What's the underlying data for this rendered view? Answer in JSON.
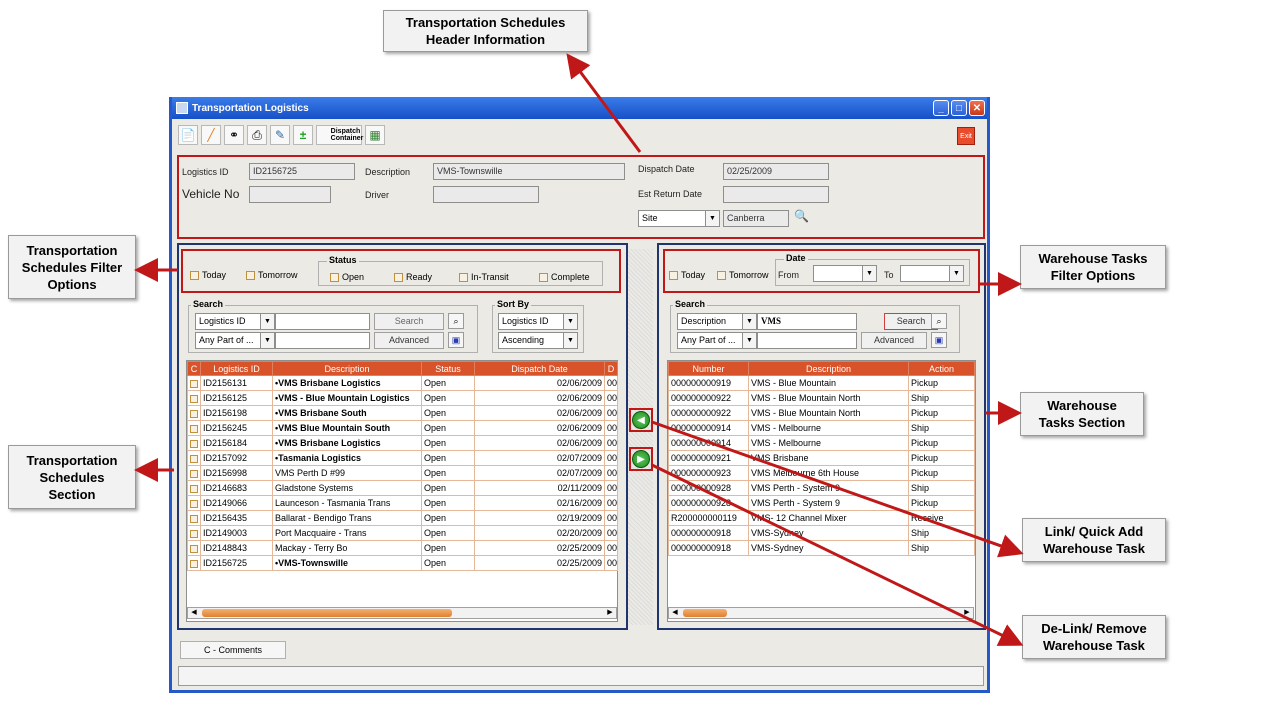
{
  "callouts": {
    "header_info": "Transportation Schedules\nHeader Information",
    "ts_filter": "Transportation\nSchedules Filter\nOptions",
    "ts_section": "Transportation\nSchedules\nSection",
    "wt_filter": "Warehouse Tasks\nFilter Options",
    "wt_section": "Warehouse\nTasks Section",
    "link": "Link/ Quick Add\nWarehouse Task",
    "delink": "De-Link/ Remove\nWarehouse Task"
  },
  "window": {
    "title": "Transportation Logistics",
    "minimize": "_",
    "maximize": "□",
    "close": "✕"
  },
  "toolbar": {
    "dispatch_label": "Dispatch\nContainer",
    "exit_label": "Exit"
  },
  "header": {
    "logistics_id_label": "Logistics ID",
    "logistics_id_value": "ID2156725",
    "description_label": "Description",
    "description_value": "VMS-Townswille",
    "dispatch_date_label": "Dispatch Date",
    "dispatch_date_value": "02/25/2009",
    "vehicle_no_label": "Vehicle No",
    "vehicle_no_value": "",
    "driver_label": "Driver",
    "driver_value": "",
    "est_return_label": "Est Return Date",
    "est_return_value": "",
    "site_label": "Site",
    "site_value": "Canberra"
  },
  "ts_filter": {
    "today": "Today",
    "tomorrow": "Tomorrow",
    "status_title": "Status",
    "open": "Open",
    "ready": "Ready",
    "in_transit": "In-Transit",
    "complete": "Complete"
  },
  "ts_search": {
    "title": "Search",
    "field": "Logistics ID",
    "match": "Any Part of ...",
    "value": "",
    "search_btn": "Search",
    "advanced_btn": "Advanced",
    "sort_title": "Sort By",
    "sort_field": "Logistics ID",
    "sort_order": "Ascending"
  },
  "ts_table": {
    "headers": [
      "C",
      "Logistics ID",
      "Description",
      "Status",
      "Dispatch Date",
      "D"
    ],
    "rows": [
      {
        "id": "ID2156131",
        "desc": "•VMS Brisbane Logistics",
        "bold": true,
        "status": "Open",
        "date": "02/06/2009",
        "d": "00"
      },
      {
        "id": "ID2156125",
        "desc": "•VMS - Blue Mountain Logistics",
        "bold": true,
        "status": "Open",
        "date": "02/06/2009",
        "d": "00"
      },
      {
        "id": "ID2156198",
        "desc": "•VMS Brisbane South",
        "bold": true,
        "status": "Open",
        "date": "02/06/2009",
        "d": "00"
      },
      {
        "id": "ID2156245",
        "desc": "•VMS Blue Mountain South",
        "bold": true,
        "status": "Open",
        "date": "02/06/2009",
        "d": "00"
      },
      {
        "id": "ID2156184",
        "desc": "•VMS Brisbane Logistics",
        "bold": true,
        "status": "Open",
        "date": "02/06/2009",
        "d": "00"
      },
      {
        "id": "ID2157092",
        "desc": "•Tasmania Logistics",
        "bold": true,
        "status": "Open",
        "date": "02/07/2009",
        "d": "00"
      },
      {
        "id": "ID2156998",
        "desc": "VMS Perth D #99",
        "bold": false,
        "status": "Open",
        "date": "02/07/2009",
        "d": "00"
      },
      {
        "id": "ID2146683",
        "desc": "Gladstone Systems",
        "bold": false,
        "status": "Open",
        "date": "02/11/2009",
        "d": "00"
      },
      {
        "id": "ID2149066",
        "desc": "Launceson - Tasmania Trans",
        "bold": false,
        "status": "Open",
        "date": "02/16/2009",
        "d": "00"
      },
      {
        "id": "ID2156435",
        "desc": "Ballarat - Bendigo Trans",
        "bold": false,
        "status": "Open",
        "date": "02/19/2009",
        "d": "00"
      },
      {
        "id": "ID2149003",
        "desc": "Port Macquaire - Trans",
        "bold": false,
        "status": "Open",
        "date": "02/20/2009",
        "d": "00"
      },
      {
        "id": "ID2148843",
        "desc": "Mackay - Terry Bo",
        "bold": false,
        "status": "Open",
        "date": "02/25/2009",
        "d": "00"
      },
      {
        "id": "ID2156725",
        "desc": "•VMS-Townswille",
        "bold": true,
        "status": "Open",
        "date": "02/25/2009",
        "d": "00"
      }
    ]
  },
  "wt_filter": {
    "date_title": "Date",
    "today": "Today",
    "tomorrow": "Tomorrow",
    "from": "From",
    "to": "To"
  },
  "wt_search": {
    "title": "Search",
    "field": "Description",
    "match": "Any Part of ...",
    "value": "VMS",
    "search_btn": "Search",
    "advanced_btn": "Advanced"
  },
  "wt_table": {
    "headers": [
      "Number",
      "Description",
      "Action"
    ],
    "rows": [
      {
        "num": "000000000919",
        "desc": "VMS - Blue Mountain",
        "action": "Pickup"
      },
      {
        "num": "000000000922",
        "desc": "VMS - Blue Mountain North",
        "action": "Ship"
      },
      {
        "num": "000000000922",
        "desc": "VMS - Blue Mountain North",
        "action": "Pickup"
      },
      {
        "num": "000000000914",
        "desc": "VMS - Melbourne",
        "action": "Ship"
      },
      {
        "num": "000000000914",
        "desc": "VMS - Melbourne",
        "action": "Pickup"
      },
      {
        "num": "000000000921",
        "desc": "VMS Brisbane",
        "action": "Pickup"
      },
      {
        "num": "000000000923",
        "desc": "VMS Melbourne 6th House",
        "action": "Pickup"
      },
      {
        "num": "000000000928",
        "desc": "VMS Perth - System 9",
        "action": "Ship"
      },
      {
        "num": "000000000928",
        "desc": "VMS Perth - System 9",
        "action": "Pickup"
      },
      {
        "num": "R200000000119",
        "desc": "VMS- 12 Channel Mixer",
        "action": "Receive"
      },
      {
        "num": "000000000918",
        "desc": "VMS-Sydney",
        "action": "Ship"
      },
      {
        "num": "000000000918",
        "desc": "VMS-Sydney",
        "action": "Ship"
      }
    ]
  },
  "bottom": {
    "tab_comments": "C - Comments"
  },
  "colors": {
    "highlight": "#c01818",
    "grid_header": "#d8532a",
    "panel_border": "#20346e"
  }
}
